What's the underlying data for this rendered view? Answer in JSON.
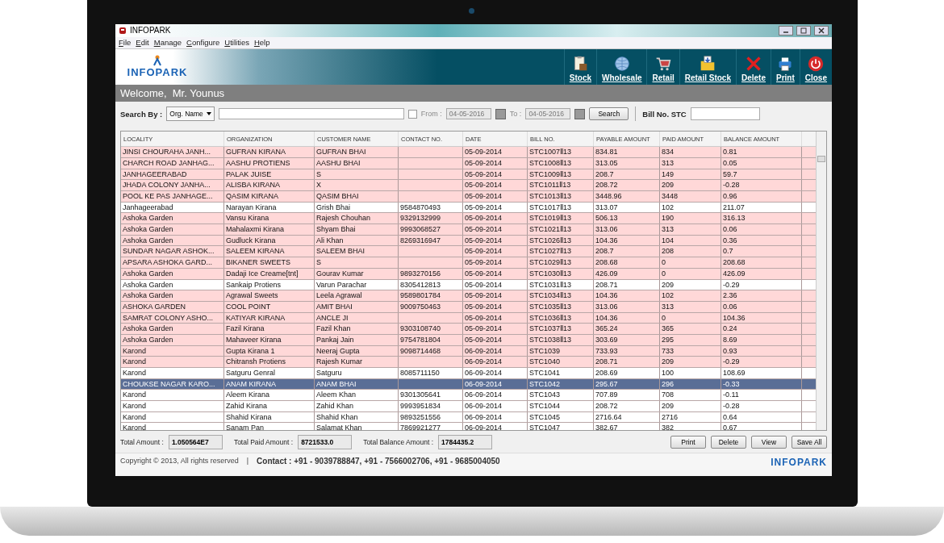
{
  "window": {
    "title": "INFOPARK"
  },
  "menu": [
    "File",
    "Edit",
    "Manage",
    "Configure",
    "Utilities",
    "Help"
  ],
  "logo": "INFOPARK",
  "toolbar": [
    {
      "label": "Stock",
      "kind": "stock"
    },
    {
      "label": "Wholesale",
      "kind": "wholesale"
    },
    {
      "label": "Retail",
      "kind": "retail"
    },
    {
      "label": "Retail Stock",
      "kind": "retail-stock"
    },
    {
      "label": "Delete",
      "kind": "delete"
    },
    {
      "label": "Print",
      "kind": "print"
    },
    {
      "label": "Close",
      "kind": "close"
    }
  ],
  "welcome": "Welcome,  Mr. Younus",
  "search": {
    "label": "Search By :",
    "search_by": "Org. Name",
    "date_filter_checked": false,
    "from_label": "From :",
    "from": "04-05-2016",
    "to_label": "To :",
    "to": "04-05-2016",
    "button": "Search",
    "bill_label": "Bill No. STC"
  },
  "table": {
    "columns": [
      "LOCALITY",
      "ORGANIZATION",
      "CUSTOMER NAME",
      "CONTACT NO.",
      "DATE",
      "BILL NO.",
      "PAYABLE AMOUNT",
      "PAID AMOUNT",
      "BALANCE AMOUNT"
    ],
    "rows": [
      {
        "cells": [
          "JINSI CHOURAHA JANH...",
          "GUFRAN KIRANA",
          "GUFRAN BHAI",
          null,
          "05-09-2014",
          "STC1007Ⅱ13",
          "834.81",
          "834",
          "0.81"
        ],
        "highlighted": true,
        "selected": false
      },
      {
        "cells": [
          "CHARCH ROAD JANHAG...",
          "AASHU PROTIENS",
          "AASHU BHAI",
          null,
          "05-09-2014",
          "STC1008Ⅱ13",
          "313.05",
          "313",
          "0.05"
        ],
        "highlighted": true,
        "selected": false
      },
      {
        "cells": [
          "JANHAGEERABAD",
          "PALAK JUISE",
          "S",
          null,
          "05-09-2014",
          "STC1009Ⅱ13",
          "208.7",
          "149",
          "59.7"
        ],
        "highlighted": true,
        "selected": false
      },
      {
        "cells": [
          "JHADA COLONY JANHA...",
          "ALISBA KIRANA",
          "X",
          null,
          "05-09-2014",
          "STC1011Ⅱ13",
          "208.72",
          "209",
          "-0.28"
        ],
        "highlighted": true,
        "selected": false
      },
      {
        "cells": [
          "POOL KE PAS JANHAGE...",
          "QASIM KIRANA",
          "QASIM BHAI",
          null,
          "05-09-2014",
          "STC1013Ⅱ13",
          "3448.96",
          "3448",
          "0.96"
        ],
        "highlighted": true,
        "selected": false
      },
      {
        "cells": [
          "Janhageerabad",
          "Narayan Kirana",
          "Grish Bhai",
          "9584870493",
          "05-09-2014",
          "STC1017Ⅱ13",
          "313.07",
          "102",
          "211.07"
        ],
        "highlighted": false,
        "selected": false
      },
      {
        "cells": [
          "Ashoka Garden",
          "Vansu Kirana",
          "Rajesh Chouhan",
          "9329132999",
          "05-09-2014",
          "STC1019Ⅱ13",
          "506.13",
          "190",
          "316.13"
        ],
        "highlighted": true,
        "selected": false
      },
      {
        "cells": [
          "Ashoka Garden",
          "Mahalaxmi Kirana",
          "Shyam Bhai",
          "9993068527",
          "05-09-2014",
          "STC1021Ⅱ13",
          "313.06",
          "313",
          "0.06"
        ],
        "highlighted": true,
        "selected": false
      },
      {
        "cells": [
          "Ashoka Garden",
          "Gudluck Kirana",
          "Ali Khan",
          "8269316947",
          "05-09-2014",
          "STC1026Ⅱ13",
          "104.36",
          "104",
          "0.36"
        ],
        "highlighted": true,
        "selected": false
      },
      {
        "cells": [
          "SUNDAR NAGAR ASHOK...",
          "SALEEM KIRANA",
          "SALEEM BHAI",
          null,
          "05-09-2014",
          "STC1027Ⅱ13",
          "208.7",
          "208",
          "0.7"
        ],
        "highlighted": true,
        "selected": false
      },
      {
        "cells": [
          "APSARA ASHOKA GARD...",
          "BIKANER SWEETS",
          "S",
          null,
          "05-09-2014",
          "STC1029Ⅱ13",
          "208.68",
          "0",
          "208.68"
        ],
        "highlighted": true,
        "selected": false
      },
      {
        "cells": [
          "Ashoka Garden",
          "Dadaji Ice Creame[tnt]",
          "Gourav Kumar",
          "9893270156",
          "05-09-2014",
          "STC1030Ⅱ13",
          "426.09",
          "0",
          "426.09"
        ],
        "highlighted": true,
        "selected": false
      },
      {
        "cells": [
          "Ashoka Garden",
          "Sankaip Protiens",
          "Varun Parachar",
          "8305412813",
          "05-09-2014",
          "STC1031Ⅱ13",
          "208.71",
          "209",
          "-0.29"
        ],
        "highlighted": false,
        "selected": false
      },
      {
        "cells": [
          "Ashoka Garden",
          "Agrawal Sweets",
          "Leela Agrawal",
          "9589801784",
          "05-09-2014",
          "STC1034Ⅱ13",
          "104.36",
          "102",
          "2.36"
        ],
        "highlighted": true,
        "selected": false
      },
      {
        "cells": [
          "ASHOKA GARDEN",
          "COOL POINT",
          "AMIT BHAI",
          "9009750463",
          "05-09-2014",
          "STC1035Ⅱ13",
          "313.06",
          "313",
          "0.06"
        ],
        "highlighted": true,
        "selected": false
      },
      {
        "cells": [
          "SAMRAT COLONY ASHO...",
          "KATIYAR KIRANA",
          "ANCLE JI",
          null,
          "05-09-2014",
          "STC1036Ⅱ13",
          "104.36",
          "0",
          "104.36"
        ],
        "highlighted": true,
        "selected": false
      },
      {
        "cells": [
          "Ashoka Garden",
          "Fazil Kirana",
          "Fazil Khan",
          "9303108740",
          "05-09-2014",
          "STC1037Ⅱ13",
          "365.24",
          "365",
          "0.24"
        ],
        "highlighted": true,
        "selected": false
      },
      {
        "cells": [
          "Ashoka Garden",
          "Mahaveer Kirana",
          "Pankaj Jain",
          "9754781804",
          "05-09-2014",
          "STC1038Ⅱ13",
          "303.69",
          "295",
          "8.69"
        ],
        "highlighted": true,
        "selected": false
      },
      {
        "cells": [
          "Karond",
          "Gupta Kirana 1",
          "Neeraj Gupta",
          "9098714468",
          "06-09-2014",
          "STC1039",
          "733.93",
          "733",
          "0.93"
        ],
        "highlighted": true,
        "selected": false
      },
      {
        "cells": [
          "Karond",
          "Chitransh Protiens",
          "Rajesh Kumar",
          null,
          "06-09-2014",
          "STC1040",
          "208.71",
          "209",
          "-0.29"
        ],
        "highlighted": true,
        "selected": false
      },
      {
        "cells": [
          "Karond",
          "Satguru Genral",
          "Satguru",
          "8085711150",
          "06-09-2014",
          "STC1041",
          "208.69",
          "100",
          "108.69"
        ],
        "highlighted": false,
        "selected": false
      },
      {
        "cells": [
          "CHOUKSE NAGAR KARO...",
          "ANAM KIRANA",
          "ANAM BHAI",
          null,
          "06-09-2014",
          "STC1042",
          "295.67",
          "296",
          "-0.33"
        ],
        "selected": true
      },
      {
        "cells": [
          "Karond",
          "Aleem Kirana",
          "Aleem Khan",
          "9301305641",
          "06-09-2014",
          "STC1043",
          "707.89",
          "708",
          "-0.11"
        ],
        "highlighted": false,
        "selected": false
      },
      {
        "cells": [
          "Karond",
          "Zahid Kirana",
          "Zahid Khan",
          "9993951834",
          "06-09-2014",
          "STC1044",
          "208.72",
          "209",
          "-0.28"
        ],
        "highlighted": false,
        "selected": false
      },
      {
        "cells": [
          "Karond",
          "Shahid Kirana",
          "Shahid Khan",
          "9893251556",
          "06-09-2014",
          "STC1045",
          "2716.64",
          "2716",
          "0.64"
        ],
        "highlighted": false,
        "selected": false
      },
      {
        "cells": [
          "Karond",
          "Sanam Pan",
          "Salamat Khan",
          "7869921277",
          "06-09-2014",
          "STC1047",
          "382.67",
          "382",
          "0.67"
        ],
        "highlighted": false,
        "selected": false
      }
    ]
  },
  "totals": [
    {
      "label": "Total Amount :",
      "value": "1.050564E7"
    },
    {
      "label": "Total Paid Amount :",
      "value": "8721533.0"
    },
    {
      "label": "Total Balance Amount :",
      "value": "1784435.2"
    }
  ],
  "buttons": [
    "Print",
    "Delete",
    "View",
    "Save All"
  ],
  "footer": {
    "copyright": "Copyright © 2013, All rights reserved",
    "separator": "|",
    "contact": "Contact : +91 - 9039788847, +91 - 7566002706, +91 - 9685004050",
    "logo": "INFOPARK"
  }
}
